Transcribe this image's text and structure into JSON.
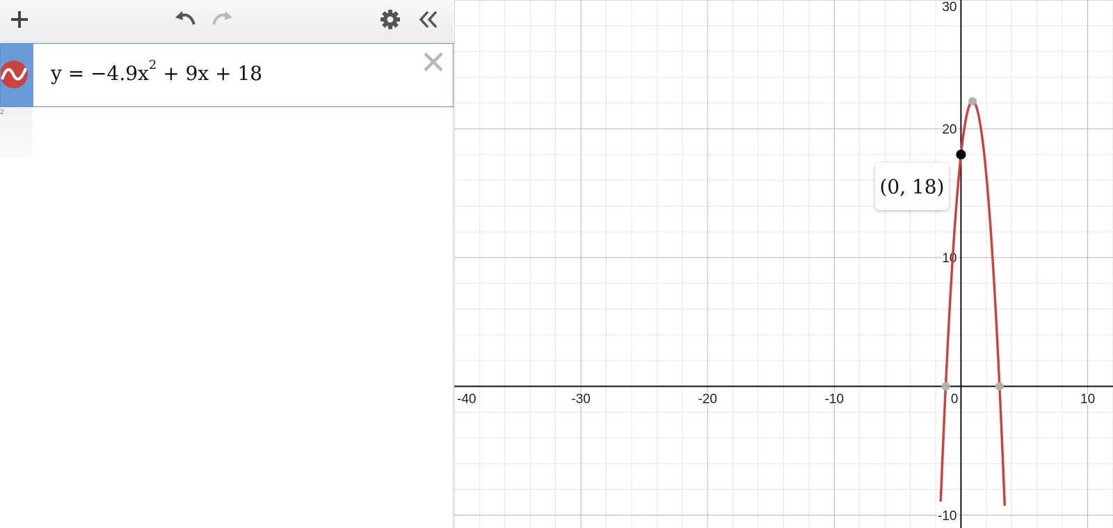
{
  "toolbar": {
    "add_icon": "plus-icon",
    "undo_icon": "undo-icon",
    "redo_icon": "redo-icon",
    "settings_icon": "gear-icon",
    "collapse_icon": "double-chevron-left-icon"
  },
  "expressions": [
    {
      "index": "2",
      "lhs": "y = −4.9x",
      "exponent": "2",
      "rhs": " + 9x + 18",
      "color": "#c74440",
      "selected": true
    }
  ],
  "graph": {
    "xlim": [
      -40,
      12
    ],
    "ylim": [
      -11,
      30
    ],
    "x_ticks": [
      "-40",
      "-30",
      "-20",
      "-10",
      "0",
      "10"
    ],
    "y_ticks": [
      "30",
      "20",
      "10",
      "-10"
    ],
    "curve_color": "#c74440",
    "function": "-4.9*x^2+9*x+18",
    "points": [
      {
        "x": 0,
        "y": 18,
        "label": "(0, 18)",
        "style": "black"
      },
      {
        "x": 0.918,
        "y": 22.13,
        "style": "gray"
      },
      {
        "x": -1.195,
        "y": 0,
        "style": "gray"
      },
      {
        "x": 3.032,
        "y": 0,
        "style": "gray"
      }
    ],
    "tooltip": "(0, 18)"
  }
}
